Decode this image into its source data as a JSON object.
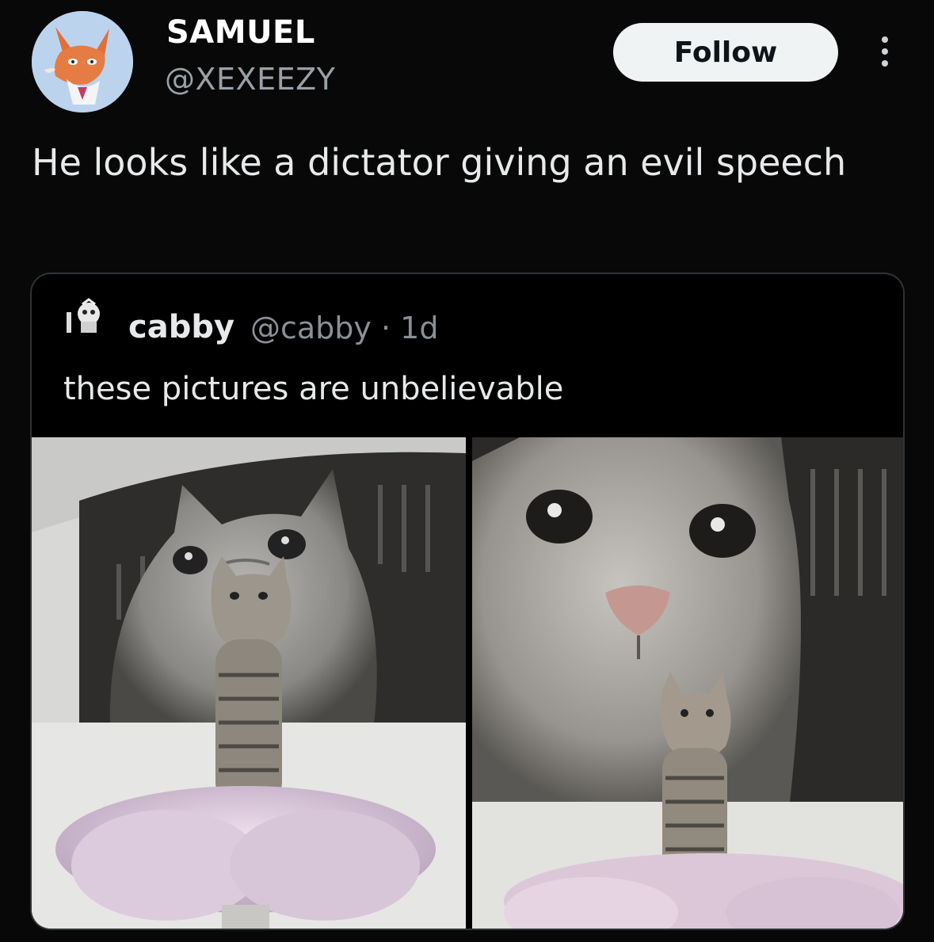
{
  "author": {
    "display_name": "SAMUEL",
    "handle": "@XEXEEZY",
    "avatar_icon": "cartoon-fox-avatar-icon"
  },
  "actions": {
    "follow_label": "Follow",
    "more_icon": "more-options-icon"
  },
  "tweet": {
    "text": "He looks like a dictator giving an evil speech"
  },
  "quoted_tweet": {
    "display_name": "cabby",
    "meta": "@cabby · 1d",
    "text": "these pictures are unbelievable",
    "avatar_icon": "skull-avatar-icon",
    "images": [
      "cat-photo-left",
      "cat-photo-right"
    ]
  },
  "colors": {
    "background": "#080808",
    "text": "#e7e9ea",
    "muted": "#8b9096",
    "button_bg": "#eff3f4"
  }
}
